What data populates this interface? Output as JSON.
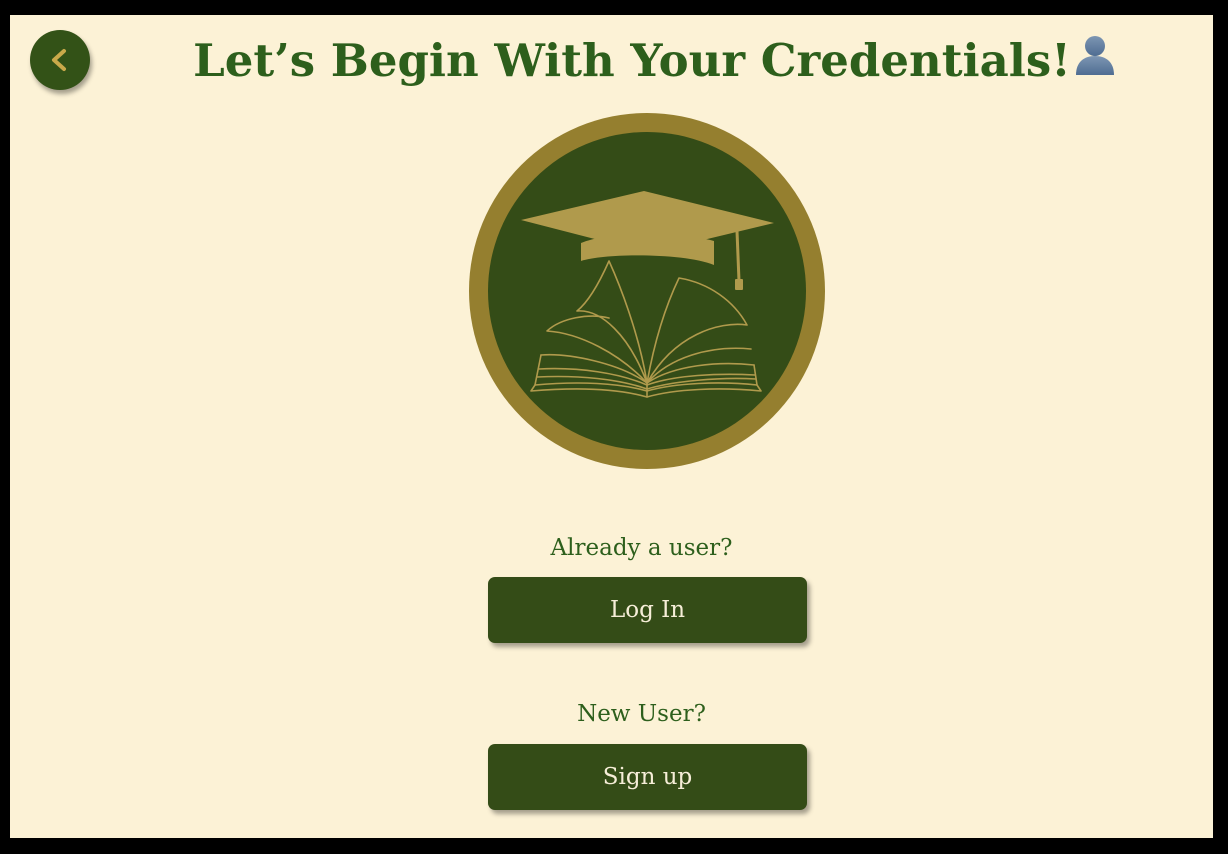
{
  "header": {
    "title": "Let’s Begin With Your Credentials!",
    "back_icon": "chevron-left-icon",
    "title_icon": "person-silhouette-icon"
  },
  "logo": {
    "icon": "graduation-cap-on-open-book-logo"
  },
  "login": {
    "prompt": "Already a user?",
    "button_label": "Log In"
  },
  "signup": {
    "prompt": "New User?",
    "button_label": "Sign up"
  },
  "colors": {
    "background": "#fcf2d6",
    "primary_green": "#344c17",
    "title_green": "#2d5f1c",
    "gold": "#957f2f",
    "gold_light": "#b09a4c",
    "button_text": "#f6eed8"
  }
}
